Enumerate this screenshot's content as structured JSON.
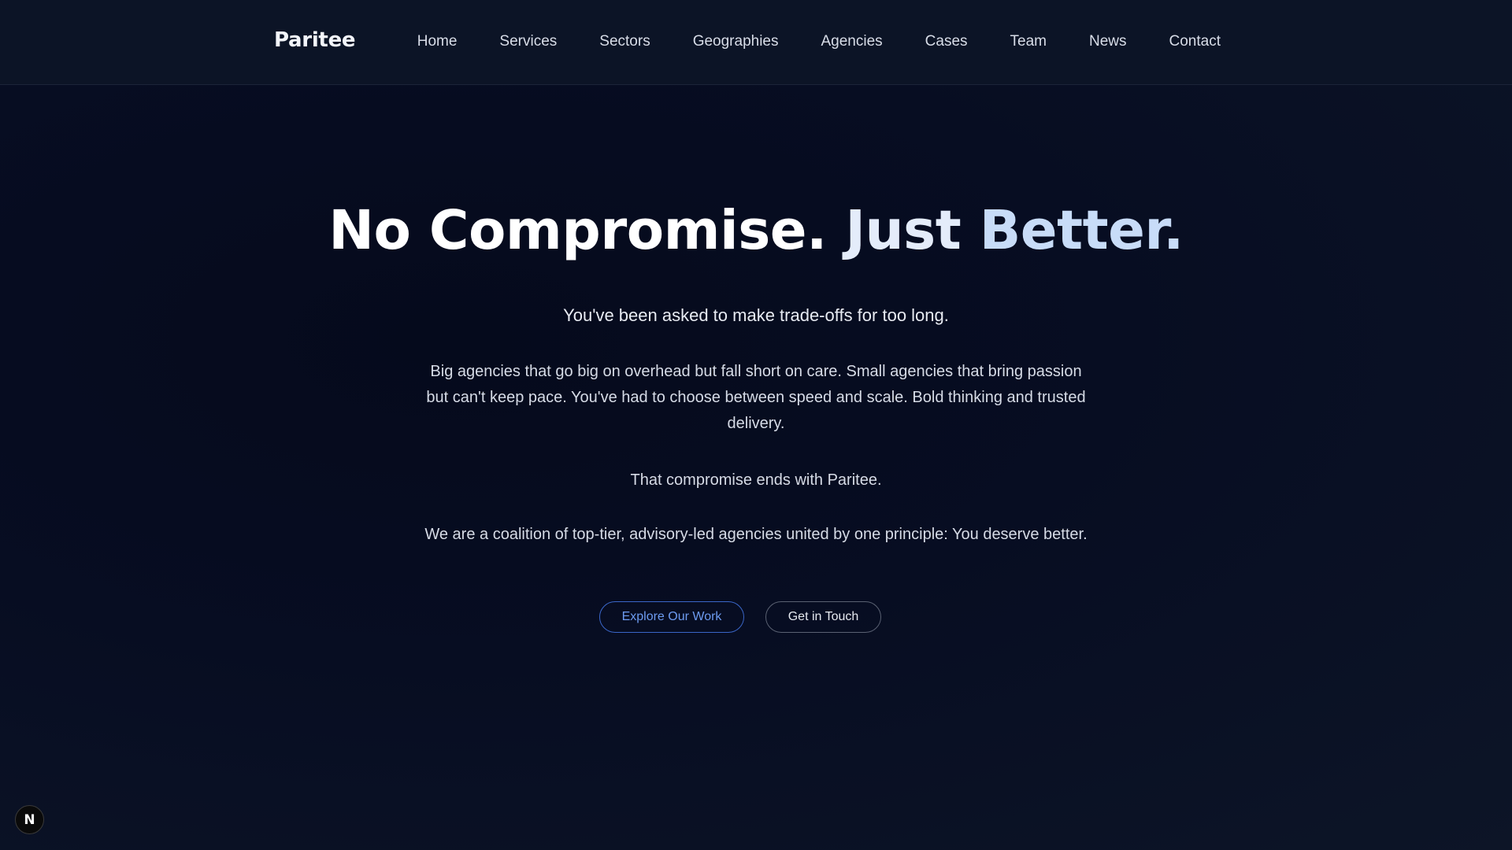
{
  "header": {
    "brand": "Paritee",
    "nav": [
      "Home",
      "Services",
      "Sectors",
      "Geographies",
      "Agencies",
      "Cases",
      "Team",
      "News",
      "Contact"
    ]
  },
  "hero": {
    "headline_part1": "No Compromise.",
    "headline_part2": "Just",
    "headline_part3": "Better.",
    "lead": "You've been asked to make trade-offs for too long.",
    "paragraph1": "Big agencies that go big on overhead but fall short on care. Small agencies that bring passion but can't keep pace. You've had to choose between speed and scale. Bold thinking and trusted delivery.",
    "paragraph2": "That compromise ends with Paritee.",
    "paragraph3": "We are a coalition of top-tier, advisory-led agencies united by one principle: You deserve better.",
    "primary_button": "Explore Our Work",
    "secondary_button": "Get in Touch"
  },
  "dev_badge": {
    "label": "N",
    "icon": "nextjs-icon"
  },
  "colors": {
    "background": "#070d22",
    "navbar": "#0c1426",
    "accent": "#3a66c8"
  }
}
